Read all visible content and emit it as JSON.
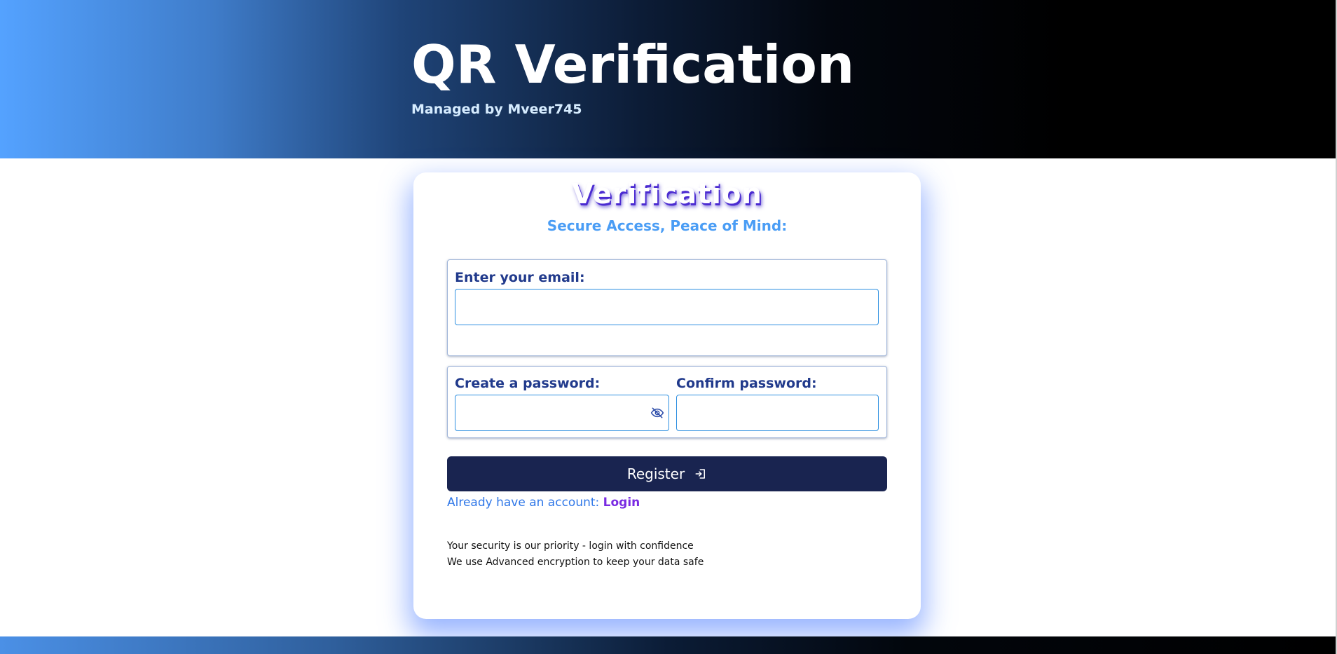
{
  "header": {
    "title": "QR Verification",
    "subtitle": "Managed by Mveer745"
  },
  "card": {
    "title": "Verification",
    "subtitle": "Secure Access, Peace of Mind:",
    "email": {
      "label": "Enter your email:",
      "value": "",
      "placeholder": ""
    },
    "password": {
      "label": "Create a password:",
      "value": "",
      "placeholder": "",
      "toggle_icon": "eye-slash-icon"
    },
    "confirm": {
      "label": "Confirm password:",
      "value": "",
      "placeholder": ""
    },
    "register_button": {
      "label": "Register",
      "icon": "login-icon"
    },
    "account_prompt": "Already have an account:",
    "login_link": "Login",
    "notes": [
      "Your security is our priority - login with confidence",
      "We use Advanced encryption to keep your data safe"
    ]
  },
  "colors": {
    "header_gradient_start": "#54a2ff",
    "header_gradient_end": "#000000",
    "button_bg": "#192450",
    "label_color": "#213a8c",
    "subtitle_color": "#4a9df5",
    "link_color": "#7a2be2",
    "prompt_color": "#2f77e8",
    "card_shadow": "#4678ff"
  }
}
